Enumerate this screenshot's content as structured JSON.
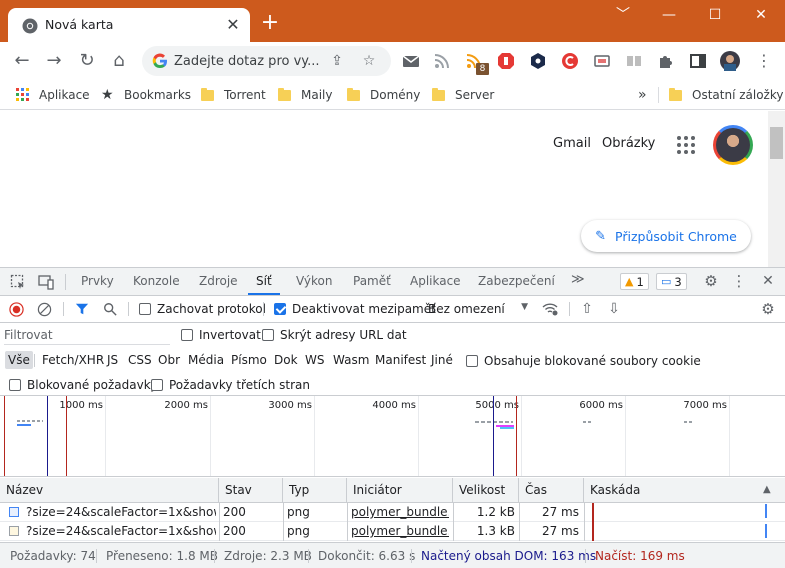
{
  "tab": {
    "title": "Nová karta",
    "close": "✕"
  },
  "window": {
    "minimize": "﹀",
    "restore": "—",
    "maximize": "☐",
    "close": "✕"
  },
  "toolbar": {
    "omnibox_placeholder": "Zadejte dotaz pro vy...",
    "rss_badge": "8"
  },
  "bookmarks": {
    "items": [
      "Aplikace",
      "Bookmarks",
      "Torrent",
      "Maily",
      "Domény",
      "Server"
    ],
    "more": "»",
    "other": "Ostatní záložky"
  },
  "page": {
    "gmail": "Gmail",
    "images": "Obrázky",
    "customize": "Přizpůsobit Chrome"
  },
  "devtools": {
    "tabs": [
      "Prvky",
      "Konzole",
      "Zdroje",
      "Síť",
      "Výkon",
      "Paměť",
      "Aplikace",
      "Zabezpečení"
    ],
    "more_tabs": "≫",
    "warnings": "1",
    "messages": "3",
    "preserve_log": "Zachovat protokol",
    "disable_cache": "Deaktivovat mezipaměť",
    "throttling": "Bez omezení",
    "filter_placeholder": "Filtrovat",
    "invert": "Invertovat",
    "hide_data_urls": "Skrýt adresy URL dat",
    "types": [
      "Vše",
      "Fetch/XHR",
      "JS",
      "CSS",
      "Obr",
      "Média",
      "Písmo",
      "Dok",
      "WS",
      "Wasm",
      "Manifest",
      "Jiné"
    ],
    "blocked_cookies": "Obsahuje blokované soubory cookie",
    "blocked_requests": "Blokované požadavky",
    "third_party": "Požadavky třetích stran",
    "ticks": [
      "1000 ms",
      "2000 ms",
      "3000 ms",
      "4000 ms",
      "5000 ms",
      "6000 ms",
      "7000 ms"
    ],
    "columns": [
      "Název",
      "Stav",
      "Typ",
      "Iniciátor",
      "Velikost",
      "Čas",
      "Kaskáda"
    ],
    "rows": [
      {
        "name": "?size=24&scaleFactor=1x&showF...",
        "status": "200",
        "type": "png",
        "initiator": "polymer_bundle...",
        "size": "1.2 kB",
        "time": "27 ms"
      },
      {
        "name": "?size=24&scaleFactor=1x&showF...",
        "status": "200",
        "type": "png",
        "initiator": "polymer_bundle...",
        "size": "1.3 kB",
        "time": "27 ms"
      }
    ],
    "status": {
      "requests": "Požadavky: 74",
      "transferred": "Přeneseno: 1.8 MB",
      "resources": "Zdroje: 2.3 MB",
      "finished": "Dokončit: 6.63 s",
      "dom": "Načtený obsah DOM: 163 ms",
      "load": "Načíst: 169 ms"
    }
  },
  "colors": {
    "titlebar": "#cd5a1d",
    "accent": "#1a73e8",
    "dom_line": "#1a1a8c",
    "load_line": "#b3261e"
  }
}
